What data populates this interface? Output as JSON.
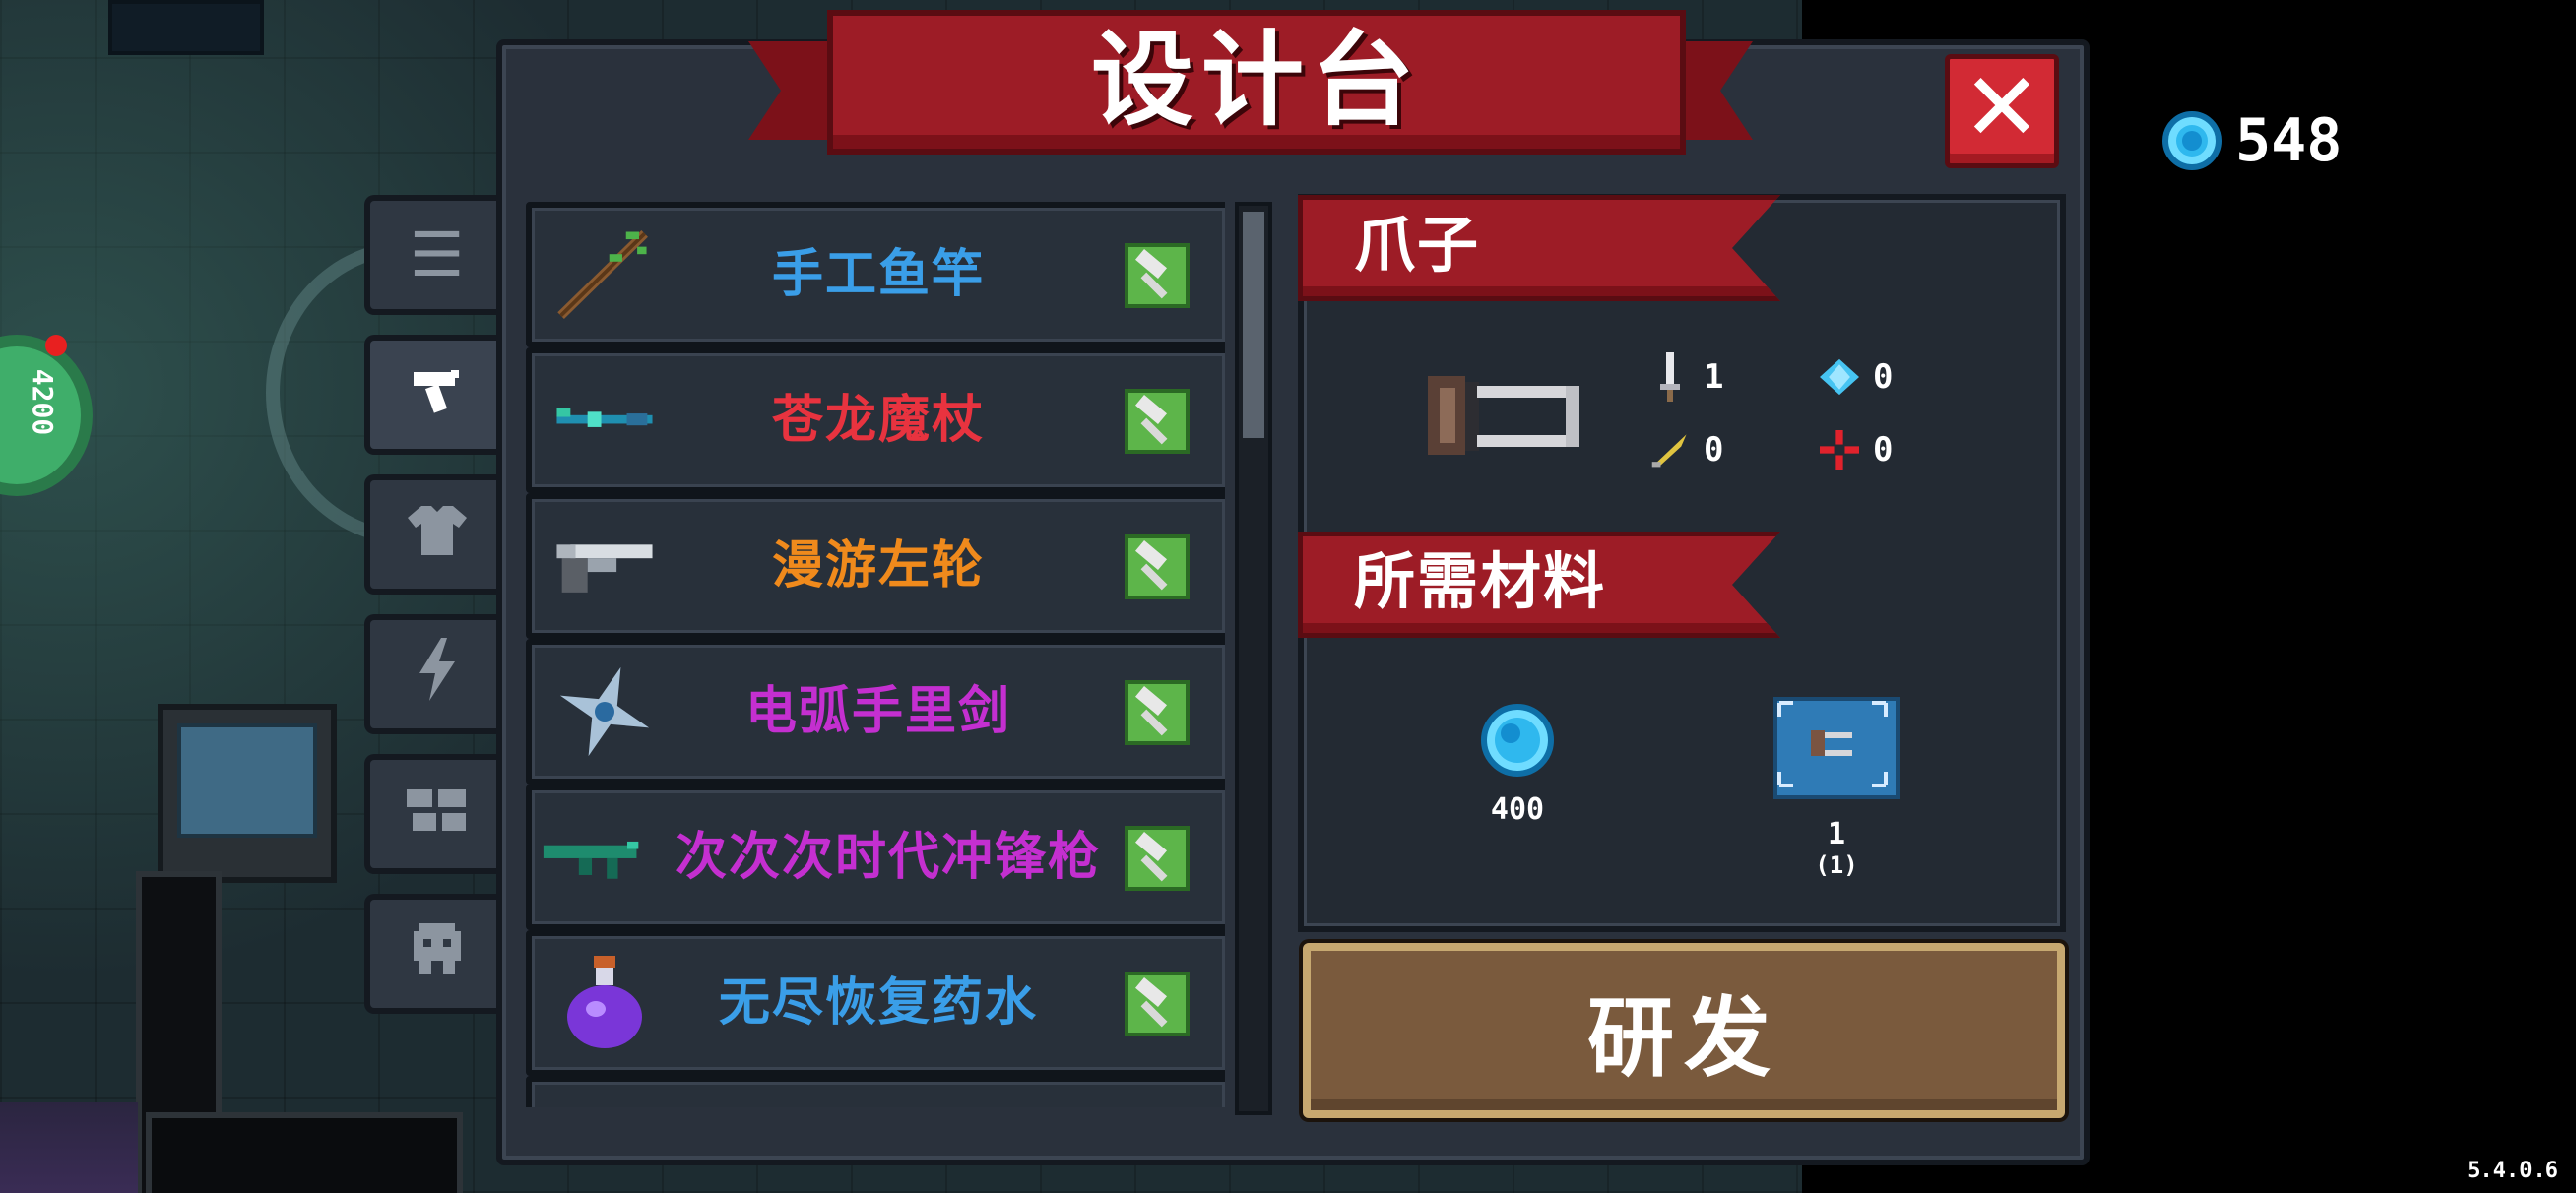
{
  "title": "设计台",
  "gem_count": "548",
  "close_label": "✕",
  "side_tabs": [
    {
      "icon": "list-icon",
      "glyph": "☰"
    },
    {
      "icon": "gun-icon",
      "glyph": "⌐"
    },
    {
      "icon": "shirt-icon",
      "glyph": "👕"
    },
    {
      "icon": "lightning-icon",
      "glyph": "ϟ"
    },
    {
      "icon": "materials-icon",
      "glyph": "▦"
    },
    {
      "icon": "creature-icon",
      "glyph": "☗"
    }
  ],
  "items": [
    {
      "name": "手工鱼竿",
      "color": "#3a9ee8",
      "icon": "fishing-rod-icon"
    },
    {
      "name": "苍龙魔杖",
      "color": "#e8333f",
      "icon": "dragon-staff-icon"
    },
    {
      "name": "漫游左轮",
      "color": "#f08a1c",
      "icon": "revolver-icon"
    },
    {
      "name": "电弧手里剑",
      "color": "#c42fd0",
      "icon": "shuriken-icon"
    },
    {
      "name": "次次次时代冲锋枪",
      "color": "#c42fd0",
      "icon": "smg-icon"
    },
    {
      "name": "无尽恢复药水",
      "color": "#3a9ee8",
      "icon": "potion-icon"
    }
  ],
  "detail": {
    "name": "爪子",
    "stats": {
      "damage": "1",
      "energy": "0",
      "crit": "0",
      "accuracy": "0"
    },
    "materials_header": "所需材料",
    "materials": [
      {
        "icon": "gem-icon",
        "amount": "400"
      },
      {
        "icon": "blueprint-icon",
        "amount": "1",
        "owned": "(1)"
      }
    ]
  },
  "research_label": "研发",
  "version": "5.4.0.6"
}
